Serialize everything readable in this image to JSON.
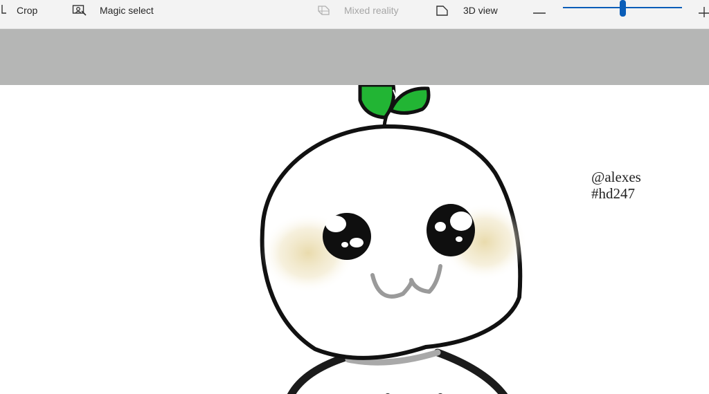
{
  "toolbar": {
    "crop_label": "Crop",
    "magic_select_label": "Magic select",
    "mixed_reality_label": "Mixed reality",
    "view_3d_label": "3D view",
    "zoom_out_icon": "minus-icon",
    "zoom_in_icon": "plus-icon",
    "zoom_level": 0.5
  },
  "canvas": {
    "signature_line1": "@alexes",
    "signature_line2": "#hd247"
  },
  "colors": {
    "toolbar_bg": "#f3f3f3",
    "band_bg": "#b5b6b5",
    "accent": "#0a5db8",
    "leaf_green": "#22b534"
  }
}
